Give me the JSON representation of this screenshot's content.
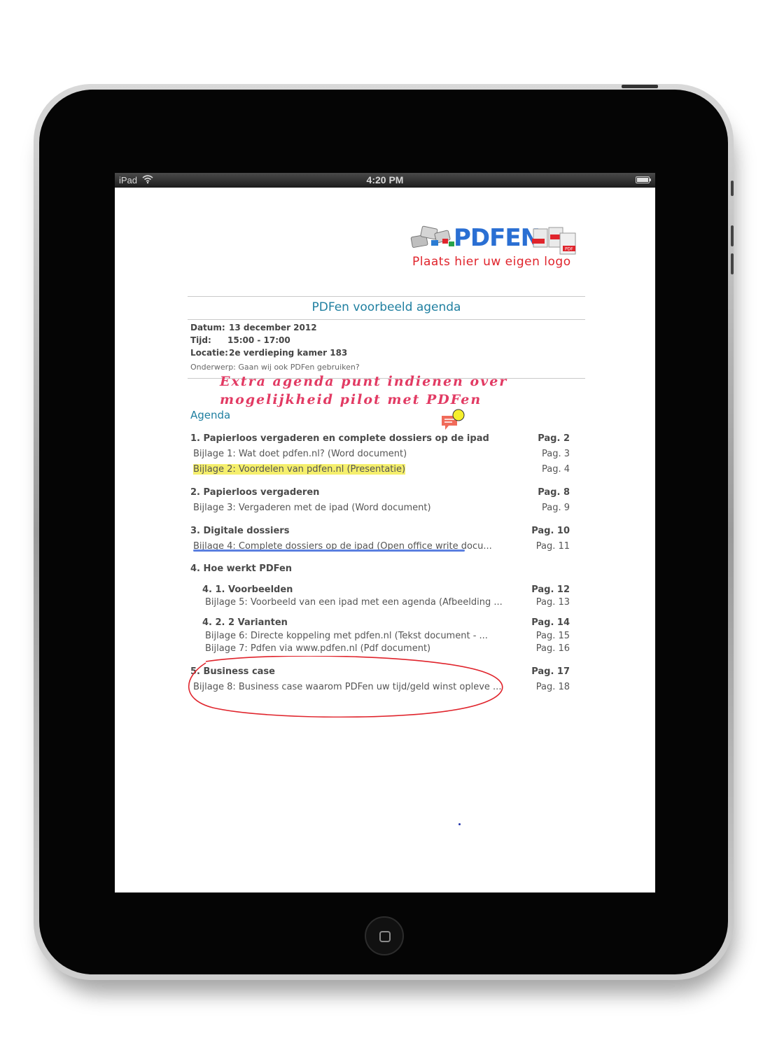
{
  "status_bar": {
    "carrier": "iPad",
    "time": "4:20 PM"
  },
  "logo": {
    "brand": "PDFEN",
    "caption": "Plaats hier uw eigen logo"
  },
  "document": {
    "title": "PDFen voorbeeld agenda",
    "meta": [
      {
        "key": "Datum:",
        "value": "13 december 2012"
      },
      {
        "key": "Tijd:",
        "value": "15:00 - 17:00"
      },
      {
        "key": "Locatie:",
        "value": "2e verdieping kamer 183"
      }
    ],
    "subject": "Onderwerp: Gaan wij ook PDFen gebruiken?",
    "handwritten_note": [
      "Extra agenda punt indienen over",
      "mogelijkheid pilot met PDFen"
    ],
    "agenda_heading": "Agenda",
    "items": [
      {
        "text": "1.  Papierloos vergaderen en complete dossiers op de ipad",
        "page": "Pag. 2"
      },
      {
        "text": "Bijlage 1: Wat doet pdfen.nl? (Word document)",
        "page": "Pag. 3"
      },
      {
        "text": "Bijlage 2: Voordelen van pdfen.nl (Presentatie)",
        "page": "Pag. 4"
      },
      {
        "text": "2.  Papierloos vergaderen",
        "page": "Pag. 8"
      },
      {
        "text": "Bijlage 3: Vergaderen met de ipad (Word document)",
        "page": "Pag. 9"
      },
      {
        "text": "3.  Digitale dossiers",
        "page": "Pag. 10"
      },
      {
        "text": "Bijlage 4: Complete dossiers op de ipad (Open office write docu...",
        "page": "Pag. 11"
      },
      {
        "text": "4.  Hoe werkt PDFen",
        "page": ""
      },
      {
        "text": "4. 1.   Voorbeelden",
        "page": "Pag. 12"
      },
      {
        "text": "Bijlage 5: Voorbeeld van een ipad met een agenda (Afbeelding ...",
        "page": "Pag. 13"
      },
      {
        "text": "4. 2.   2 Varianten",
        "page": "Pag. 14"
      },
      {
        "text": "Bijlage 6: Directe koppeling met pdfen.nl (Tekst document -   ...",
        "page": "Pag. 15"
      },
      {
        "text": "Bijlage 7: Pdfen via www.pdfen.nl (Pdf document)",
        "page": "Pag. 16"
      },
      {
        "text": "5.  Business case",
        "page": "Pag. 17"
      },
      {
        "text": "Bijlage 8: Business case waarom PDFen uw tijd/geld winst opleve ...",
        "page": "Pag. 18"
      }
    ]
  },
  "colors": {
    "accent": "#1f7fa0",
    "handwriting": "#e23a63",
    "highlight": "#f5ef6c",
    "annotation_red": "#e0242c",
    "underline_blue": "#5a7fe0"
  }
}
